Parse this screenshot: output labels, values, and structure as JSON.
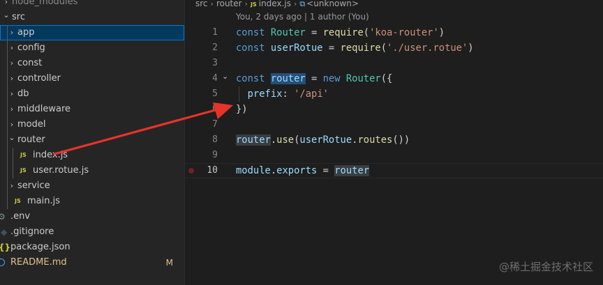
{
  "explorer": {
    "rows": [
      {
        "label": "node_modules",
        "kind": "folder-collapsed",
        "indent": 0,
        "partial": true
      },
      {
        "label": "src",
        "kind": "folder-open",
        "indent": 0
      },
      {
        "label": "app",
        "kind": "folder-collapsed",
        "indent": 1,
        "selected": true
      },
      {
        "label": "config",
        "kind": "folder-collapsed",
        "indent": 1
      },
      {
        "label": "const",
        "kind": "folder-collapsed",
        "indent": 1
      },
      {
        "label": "controller",
        "kind": "folder-collapsed",
        "indent": 1
      },
      {
        "label": "db",
        "kind": "folder-collapsed",
        "indent": 1
      },
      {
        "label": "middleware",
        "kind": "folder-collapsed",
        "indent": 1
      },
      {
        "label": "model",
        "kind": "folder-collapsed",
        "indent": 1
      },
      {
        "label": "router",
        "kind": "folder-open",
        "indent": 1
      },
      {
        "label": "index.js",
        "kind": "js",
        "indent": 2
      },
      {
        "label": "user.rotue.js",
        "kind": "js",
        "indent": 2
      },
      {
        "label": "service",
        "kind": "folder-collapsed",
        "indent": 1
      },
      {
        "label": "main.js",
        "kind": "js",
        "indent": 1
      },
      {
        "label": ".env",
        "kind": "gear",
        "indent": 0
      },
      {
        "label": ".gitignore",
        "kind": "git",
        "indent": 0
      },
      {
        "label": "package.json",
        "kind": "json",
        "indent": 0
      },
      {
        "label": "README.md",
        "kind": "info",
        "indent": 0,
        "badge": "M"
      }
    ]
  },
  "breadcrumb": {
    "items": [
      "src",
      "router",
      "index.js",
      "<unknown>"
    ],
    "js_badge": "JS"
  },
  "codelens": "You, 2 days ago | 1 author (You)",
  "code": {
    "lines": [
      {
        "no": "1",
        "tokens": [
          [
            "kw",
            "const "
          ],
          [
            "cls",
            "Router"
          ],
          [
            "",
            " = "
          ],
          [
            "fn",
            "require"
          ],
          [
            "",
            "("
          ],
          [
            "str",
            "'koa-router'"
          ],
          [
            "",
            ")"
          ]
        ]
      },
      {
        "no": "2",
        "tokens": [
          [
            "kw",
            "const "
          ],
          [
            "var",
            "userRotue"
          ],
          [
            "",
            " = "
          ],
          [
            "fn",
            "require"
          ],
          [
            "",
            "("
          ],
          [
            "str",
            "'./user.rotue'"
          ],
          [
            "",
            ")"
          ]
        ]
      },
      {
        "no": "3",
        "tokens": []
      },
      {
        "no": "4",
        "tokens": [
          [
            "kw",
            "const "
          ],
          [
            "var hl",
            "router"
          ],
          [
            "",
            " = "
          ],
          [
            "kw",
            "new "
          ],
          [
            "cls",
            "Router"
          ],
          [
            "",
            "({"
          ]
        ],
        "fold": true
      },
      {
        "no": "5",
        "tokens": [
          [
            "",
            "  "
          ],
          [
            "var",
            "prefix"
          ],
          [
            "",
            ": "
          ],
          [
            "str",
            "'/api'"
          ]
        ]
      },
      {
        "no": "6",
        "tokens": [
          [
            "",
            "})"
          ]
        ]
      },
      {
        "no": "7",
        "tokens": []
      },
      {
        "no": "8",
        "tokens": [
          [
            "var hl-soft",
            "router"
          ],
          [
            "",
            "."
          ],
          [
            "fn",
            "use"
          ],
          [
            "",
            "("
          ],
          [
            "var",
            "userRotue"
          ],
          [
            "",
            "."
          ],
          [
            "fn",
            "routes"
          ],
          [
            "",
            "())"
          ]
        ]
      },
      {
        "no": "9",
        "tokens": []
      },
      {
        "no": "10",
        "tokens": [
          [
            "var",
            "module"
          ],
          [
            "",
            "."
          ],
          [
            "var",
            "exports"
          ],
          [
            "",
            " = "
          ],
          [
            "var hl-soft",
            "router"
          ]
        ],
        "active": true,
        "breakpoint": true
      }
    ]
  },
  "watermark": "@稀土掘金技术社区",
  "colors": {
    "arrow": "#e8332a",
    "selection": "#04395e",
    "accent": "#0078d4"
  }
}
